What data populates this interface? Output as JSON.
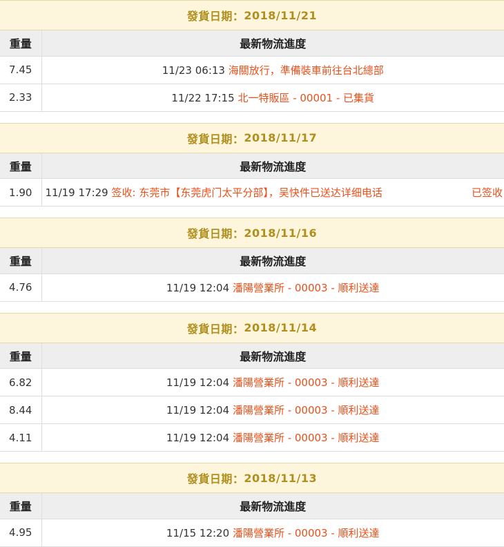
{
  "labels": {
    "date_prefix": "發貨日期：",
    "weight_header": "重量",
    "progress_header": "最新物流進度"
  },
  "colors": {
    "header_bg": "#fdf5dc",
    "header_text": "#b08f1e",
    "status_text": "#e8501a",
    "column_header_bg": "#eeeeee"
  },
  "groups": [
    {
      "date": "2018/11/21",
      "rows": [
        {
          "weight": "7.45",
          "time": "11/23 06:13",
          "status": "海關放行，準備裝車前往台北總部",
          "tail": ""
        },
        {
          "weight": "2.33",
          "time": "11/22 17:15",
          "status": "北一特販區 - 00001 - 已集貨",
          "tail": ""
        }
      ]
    },
    {
      "date": "2018/11/17",
      "rows": [
        {
          "weight": "1.90",
          "time": "11/19 17:29",
          "status": "签收: 东莞市【东莞虎门太平分部】，吴快件已送达详细电话",
          "tail": "已签收"
        }
      ]
    },
    {
      "date": "2018/11/16",
      "rows": [
        {
          "weight": "4.76",
          "time": "11/19 12:04",
          "status": "潘陽營業所 - 00003 - 順利送達",
          "tail": ""
        }
      ]
    },
    {
      "date": "2018/11/14",
      "rows": [
        {
          "weight": "6.82",
          "time": "11/19 12:04",
          "status": "潘陽營業所 - 00003 - 順利送達",
          "tail": ""
        },
        {
          "weight": "8.44",
          "time": "11/19 12:04",
          "status": "潘陽營業所 - 00003 - 順利送達",
          "tail": ""
        },
        {
          "weight": "4.11",
          "time": "11/19 12:04",
          "status": "潘陽營業所 - 00003 - 順利送達",
          "tail": ""
        }
      ]
    },
    {
      "date": "2018/11/13",
      "rows": [
        {
          "weight": "4.95",
          "time": "11/15 12:20",
          "status": "潘陽營業所 - 00003 - 順利送達",
          "tail": ""
        }
      ]
    }
  ]
}
